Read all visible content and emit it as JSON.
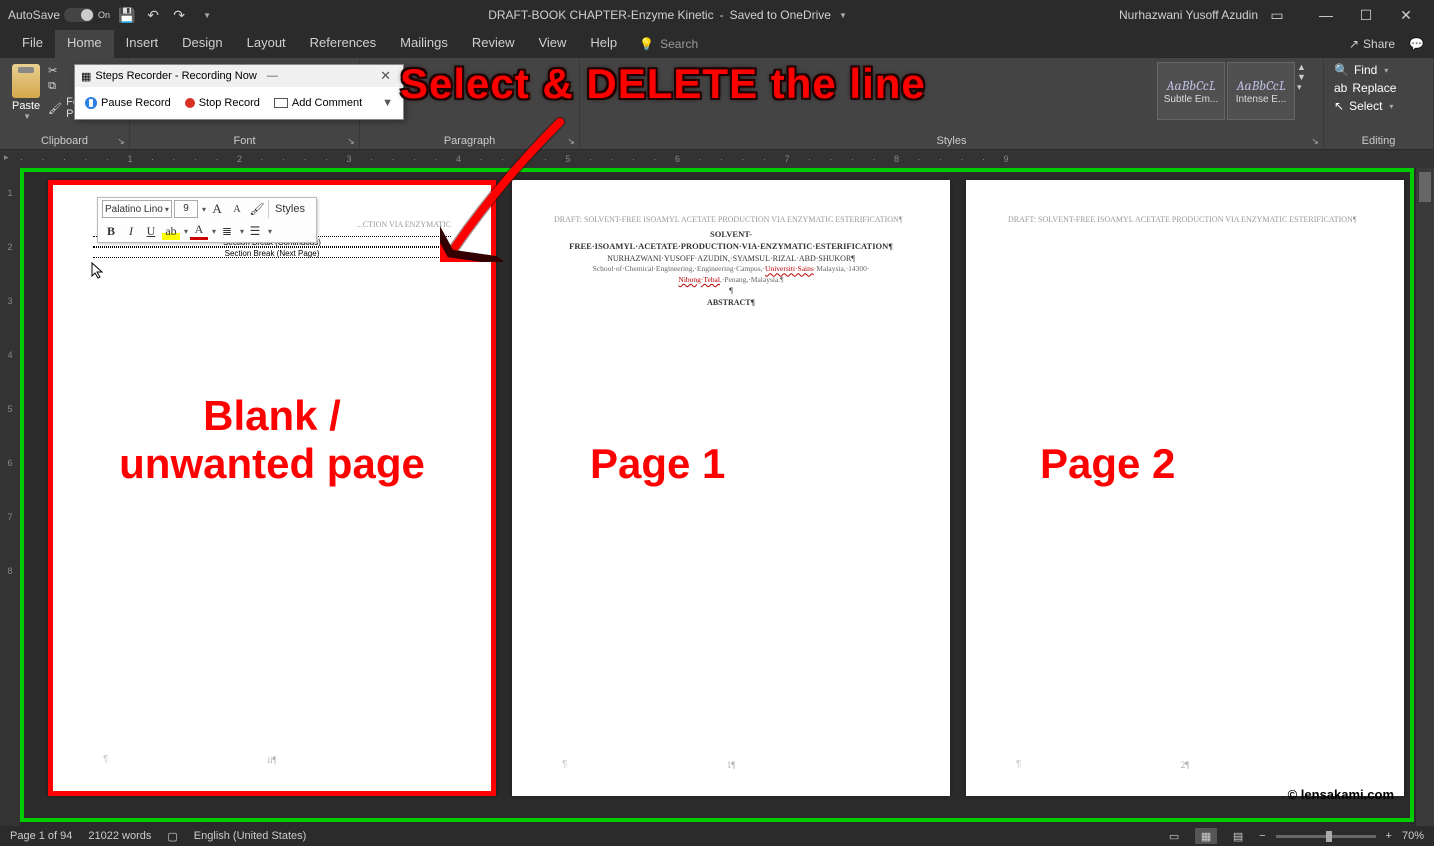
{
  "titlebar": {
    "autosave": "AutoSave",
    "autosave_state": "On",
    "doc_title": "DRAFT-BOOK CHAPTER-Enzyme Kinetic",
    "save_status": "Saved to OneDrive",
    "user": "Nurhazwani Yusoff Azudin"
  },
  "menu": {
    "file": "File",
    "home": "Home",
    "insert": "Insert",
    "design": "Design",
    "layout": "Layout",
    "references": "References",
    "mailings": "Mailings",
    "review": "Review",
    "view": "View",
    "help": "Help",
    "search": "Search",
    "share": "Share",
    "comments": "Comments"
  },
  "ribbon": {
    "clipboard": {
      "paste": "Paste",
      "cut": "Cut",
      "copy": "Copy",
      "format_painter": "Format Painter",
      "label": "Clipboard"
    },
    "font_label": "Font",
    "paragraph_label": "Paragraph",
    "styles_label": "Styles",
    "editing_label": "Editing",
    "styles": {
      "s1": "AaBbCcL",
      "s1_name": "Subtle Em...",
      "s2": "AaBbCcL",
      "s2_name": "Intense E..."
    },
    "editing": {
      "find": "Find",
      "replace": "Replace",
      "select": "Select"
    }
  },
  "steps_recorder": {
    "title": "Steps Recorder - Recording Now",
    "pause": "Pause Record",
    "stop": "Stop Record",
    "comment": "Add Comment"
  },
  "mini_toolbar": {
    "font": "Palatino Lino",
    "size": "9",
    "styles": "Styles"
  },
  "page_blank": {
    "header": "...CTION VIA ENZYMATIC",
    "break1": "Section Break (Continuous)",
    "break2": "Section Break (Next Page)",
    "footer": "ii¶"
  },
  "page1": {
    "header": "DRAFT: SOLVENT-FREE ISOAMYL ACETATE PRODUCTION VIA ENZYMATIC ESTERIFICATION¶",
    "title": "SOLVENT-FREE·ISOAMYL·ACETATE·PRODUCTION·VIA·ENZYMATIC·ESTERIFICATION¶",
    "authors": "NURHAZWANI·YUSOFF·AZUDIN,·SYAMSUL·RIZAL·ABD·SHUKOR¶",
    "affil_p1": "School·of·Chemical·Engineering,·Engineering·Campus,·",
    "affil_red1": "Universiti·Sains",
    "affil_p2": "·Malaysia,·14300·",
    "affil_red2": "Nibong·Tebal",
    "affil_p3": ",·Penang,·Malaysia.¶",
    "para": "¶",
    "abstract": "ABSTRACT¶",
    "footer": "1¶"
  },
  "page2": {
    "header": "DRAFT: SOLVENT-FREE ISOAMYL ACETATE PRODUCTION VIA ENZYMATIC ESTERIFICATION¶",
    "footer": "2¶"
  },
  "annotations": {
    "select": "Select & DELETE the line",
    "blank_l1": "Blank /",
    "blank_l2": "unwanted page",
    "page1": "Page 1",
    "page2": "Page 2",
    "watermark": "© lensakami.com"
  },
  "status": {
    "page": "Page 1 of 94",
    "words": "21022 words",
    "lang": "English (United States)",
    "zoom": "70%"
  },
  "ruler_v": [
    "",
    "1",
    "2",
    "3",
    "4",
    "5",
    "6",
    "7",
    "8"
  ]
}
